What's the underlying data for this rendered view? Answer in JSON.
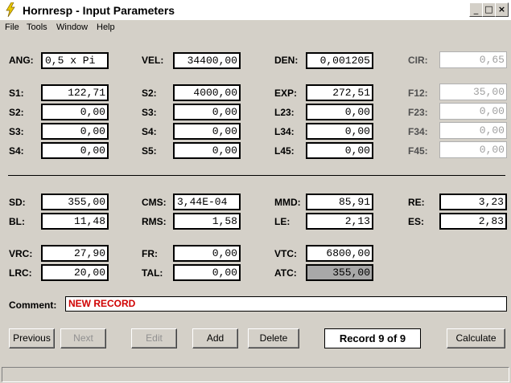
{
  "window": {
    "title": "Hornresp - Input Parameters",
    "controls": [
      "_",
      "□",
      "×"
    ]
  },
  "menu": [
    "File",
    "Tools",
    "Window",
    "Help"
  ],
  "fields": {
    "ANG": "0,5 x Pi",
    "VEL": "34400,00",
    "DEN": "0,001205",
    "CIR": "0,65",
    "S1": "122,71",
    "S2a": "4000,00",
    "EXP": "272,51",
    "F12": "35,00",
    "S2": "0,00",
    "S3a": "0,00",
    "L23": "0,00",
    "F23": "0,00",
    "S3": "0,00",
    "S4a": "0,00",
    "L34": "0,00",
    "F34": "0,00",
    "S4": "0,00",
    "S5": "0,00",
    "L45": "0,00",
    "F45": "0,00",
    "SD": "355,00",
    "CMS": "3,44E-04",
    "MMD": "85,91",
    "RE": "3,23",
    "BL": "11,48",
    "RMS": "1,58",
    "LE": "2,13",
    "ES": "2,83",
    "VRC": "27,90",
    "FR": "0,00",
    "VTC": "6800,00",
    "LRC": "20,00",
    "TAL": "0,00",
    "ATC": "355,00"
  },
  "labels": {
    "ANG": "ANG:",
    "VEL": "VEL:",
    "DEN": "DEN:",
    "CIR": "CIR:",
    "S1": "S1:",
    "S2": "S2:",
    "EXP": "EXP:",
    "F12": "F12:",
    "S3": "S3:",
    "L23": "L23:",
    "F23": "F23:",
    "S4": "S4:",
    "L34": "L34:",
    "F34": "F34:",
    "S5": "S5:",
    "L45": "L45:",
    "F45": "F45:",
    "SD": "SD:",
    "CMS": "CMS:",
    "MMD": "MMD:",
    "RE": "RE:",
    "BL": "BL:",
    "RMS": "RMS:",
    "LE": "LE:",
    "ES": "ES:",
    "VRC": "VRC:",
    "FR": "FR:",
    "VTC": "VTC:",
    "LRC": "LRC:",
    "TAL": "TAL:",
    "ATC": "ATC:"
  },
  "comment": {
    "label": "Comment:",
    "value": "NEW RECORD"
  },
  "buttons": {
    "previous": "Previous",
    "next": "Next",
    "edit": "Edit",
    "add": "Add",
    "delete": "Delete",
    "calculate": "Calculate"
  },
  "record": "Record 9 of 9",
  "colors": {
    "comment_text": "#d00000",
    "window_bg": "#d4d0c8"
  }
}
